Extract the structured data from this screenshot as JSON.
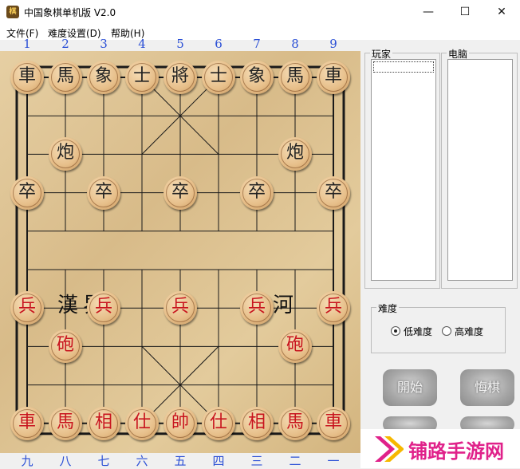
{
  "window": {
    "title": "中国象棋单机版 V2.0",
    "icon": "xiangqi-app-icon",
    "minimize": "—",
    "maximize": "☐",
    "close": "✕"
  },
  "menu": [
    "文件(F)",
    "难度设置(D)",
    "帮助(H)"
  ],
  "columns_top": [
    "1",
    "2",
    "3",
    "4",
    "5",
    "6",
    "7",
    "8",
    "9"
  ],
  "columns_bottom": [
    "九",
    "八",
    "七",
    "六",
    "五",
    "四",
    "三",
    "二",
    "一"
  ],
  "river": {
    "left": "漢界",
    "right": "楚河"
  },
  "pieces": [
    {
      "char": "車",
      "side": "black",
      "col": 0,
      "row": 0
    },
    {
      "char": "馬",
      "side": "black",
      "col": 1,
      "row": 0
    },
    {
      "char": "象",
      "side": "black",
      "col": 2,
      "row": 0
    },
    {
      "char": "士",
      "side": "black",
      "col": 3,
      "row": 0
    },
    {
      "char": "將",
      "side": "black",
      "col": 4,
      "row": 0
    },
    {
      "char": "士",
      "side": "black",
      "col": 5,
      "row": 0
    },
    {
      "char": "象",
      "side": "black",
      "col": 6,
      "row": 0
    },
    {
      "char": "馬",
      "side": "black",
      "col": 7,
      "row": 0
    },
    {
      "char": "車",
      "side": "black",
      "col": 8,
      "row": 0
    },
    {
      "char": "炮",
      "side": "black",
      "col": 1,
      "row": 2
    },
    {
      "char": "炮",
      "side": "black",
      "col": 7,
      "row": 2
    },
    {
      "char": "卒",
      "side": "black",
      "col": 0,
      "row": 3
    },
    {
      "char": "卒",
      "side": "black",
      "col": 2,
      "row": 3
    },
    {
      "char": "卒",
      "side": "black",
      "col": 4,
      "row": 3
    },
    {
      "char": "卒",
      "side": "black",
      "col": 6,
      "row": 3
    },
    {
      "char": "卒",
      "side": "black",
      "col": 8,
      "row": 3
    },
    {
      "char": "兵",
      "side": "red",
      "col": 0,
      "row": 6
    },
    {
      "char": "兵",
      "side": "red",
      "col": 2,
      "row": 6
    },
    {
      "char": "兵",
      "side": "red",
      "col": 4,
      "row": 6
    },
    {
      "char": "兵",
      "side": "red",
      "col": 6,
      "row": 6
    },
    {
      "char": "兵",
      "side": "red",
      "col": 8,
      "row": 6
    },
    {
      "char": "砲",
      "side": "red",
      "col": 1,
      "row": 7
    },
    {
      "char": "砲",
      "side": "red",
      "col": 7,
      "row": 7
    },
    {
      "char": "車",
      "side": "red",
      "col": 0,
      "row": 9
    },
    {
      "char": "馬",
      "side": "red",
      "col": 1,
      "row": 9
    },
    {
      "char": "相",
      "side": "red",
      "col": 2,
      "row": 9
    },
    {
      "char": "仕",
      "side": "red",
      "col": 3,
      "row": 9
    },
    {
      "char": "帥",
      "side": "red",
      "col": 4,
      "row": 9
    },
    {
      "char": "仕",
      "side": "red",
      "col": 5,
      "row": 9
    },
    {
      "char": "相",
      "side": "red",
      "col": 6,
      "row": 9
    },
    {
      "char": "馬",
      "side": "red",
      "col": 7,
      "row": 9
    },
    {
      "char": "車",
      "side": "red",
      "col": 8,
      "row": 9
    }
  ],
  "player_panel": {
    "label": "玩家"
  },
  "computer_panel": {
    "label": "电脑"
  },
  "difficulty": {
    "label": "难度",
    "low": "低难度",
    "high": "高难度",
    "selected": "low"
  },
  "buttons": {
    "start": "開始",
    "undo": "悔棋"
  },
  "watermark": "铺路手游网",
  "colors": {
    "red_piece": "#c8141e",
    "black_piece": "#222222",
    "column_numbers": "#2a4fd6"
  }
}
